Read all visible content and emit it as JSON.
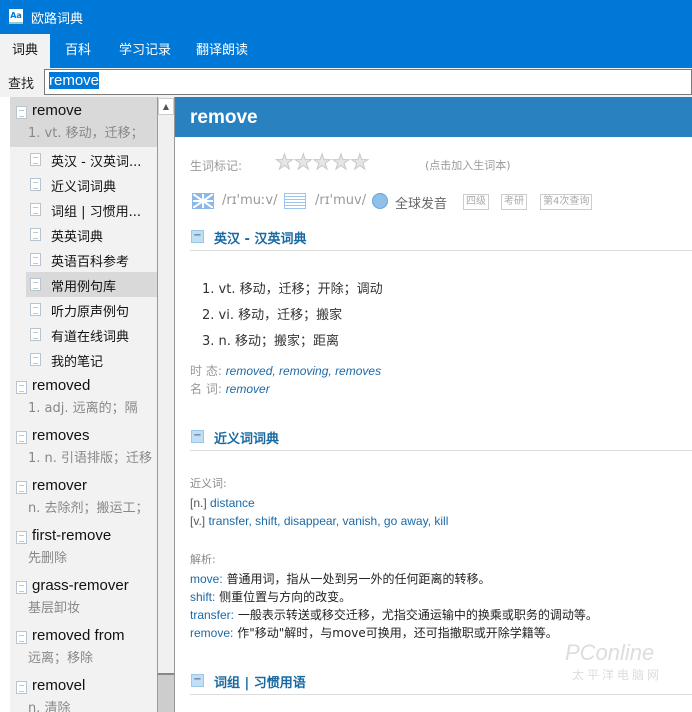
{
  "app": {
    "title": "欧路词典",
    "icon": "Aa"
  },
  "tabs": [
    "词典",
    "百科",
    "学习记录",
    "翻译朗读"
  ],
  "search": {
    "label": "查找",
    "value": "remove"
  },
  "sidebar": {
    "main": {
      "word": "remove",
      "meaning": "1. vt. 移动，迁移；"
    },
    "subs": [
      "英汉 - 汉英词...",
      "近义词词典",
      "词组 | 习惯用...",
      "英英词典",
      "英语百科参考",
      "常用例句库",
      "听力原声例句",
      "有道在线词典",
      "我的笔记"
    ],
    "results": [
      {
        "word": "removed",
        "meaning": "1. adj. 远离的；隔"
      },
      {
        "word": "removes",
        "meaning": "1. n. 引语排版；迁移"
      },
      {
        "word": "remover",
        "meaning": "n. 去除剂；搬运工；"
      },
      {
        "word": "first-remove",
        "meaning": "先删除"
      },
      {
        "word": "grass-remover",
        "meaning": "基层卸妆"
      },
      {
        "word": "removed from",
        "meaning": "远离；移除"
      },
      {
        "word": "removel",
        "meaning": "n. 清除"
      }
    ]
  },
  "entry": {
    "word": "remove",
    "mark_label": "生词标记:",
    "rating": 0,
    "mark_hint": "(点击加入生词本)",
    "uk": "/rɪ'muːv/",
    "us": "/rɪ'muv/",
    "global": "全球发音",
    "badges": [
      "四级",
      "考研",
      "第4次查询"
    ],
    "sec1": "英汉 - 汉英词典",
    "defs": [
      "1.  vt. 移动，迁移；开除；调动",
      "2.  vi. 移动，迁移；搬家",
      "3.  n. 移动；搬家；距离"
    ],
    "tense_label": "时 态:",
    "tense": "removed, removing, removes",
    "noun_label": "名 词:",
    "noun": "remover",
    "sec2": "近义词词典",
    "syn_label": "近义词:",
    "syn_n_tag": "[n.]",
    "syn_n": "distance",
    "syn_v_tag": "[v.]",
    "syn_v": "transfer, shift, disappear, vanish, go away, kill",
    "ana_label": "解析:",
    "analysis": [
      {
        "w": "move:",
        "t": "普通用词，指从一处到另一外的任何距离的转移。"
      },
      {
        "w": "shift:",
        "t": "侧重位置与方向的改变。"
      },
      {
        "w": "transfer:",
        "t": "一般表示转送或移交迁移，尤指交通运输中的换乘或职务的调动等。"
      },
      {
        "w": "remove:",
        "t": "作\"移动\"解时，与move可换用，还可指撤职或开除学籍等。"
      }
    ],
    "sec3": "词组 | 习惯用语"
  },
  "watermark": {
    "logo": "PConline",
    "sub": "太平洋电脑网"
  }
}
